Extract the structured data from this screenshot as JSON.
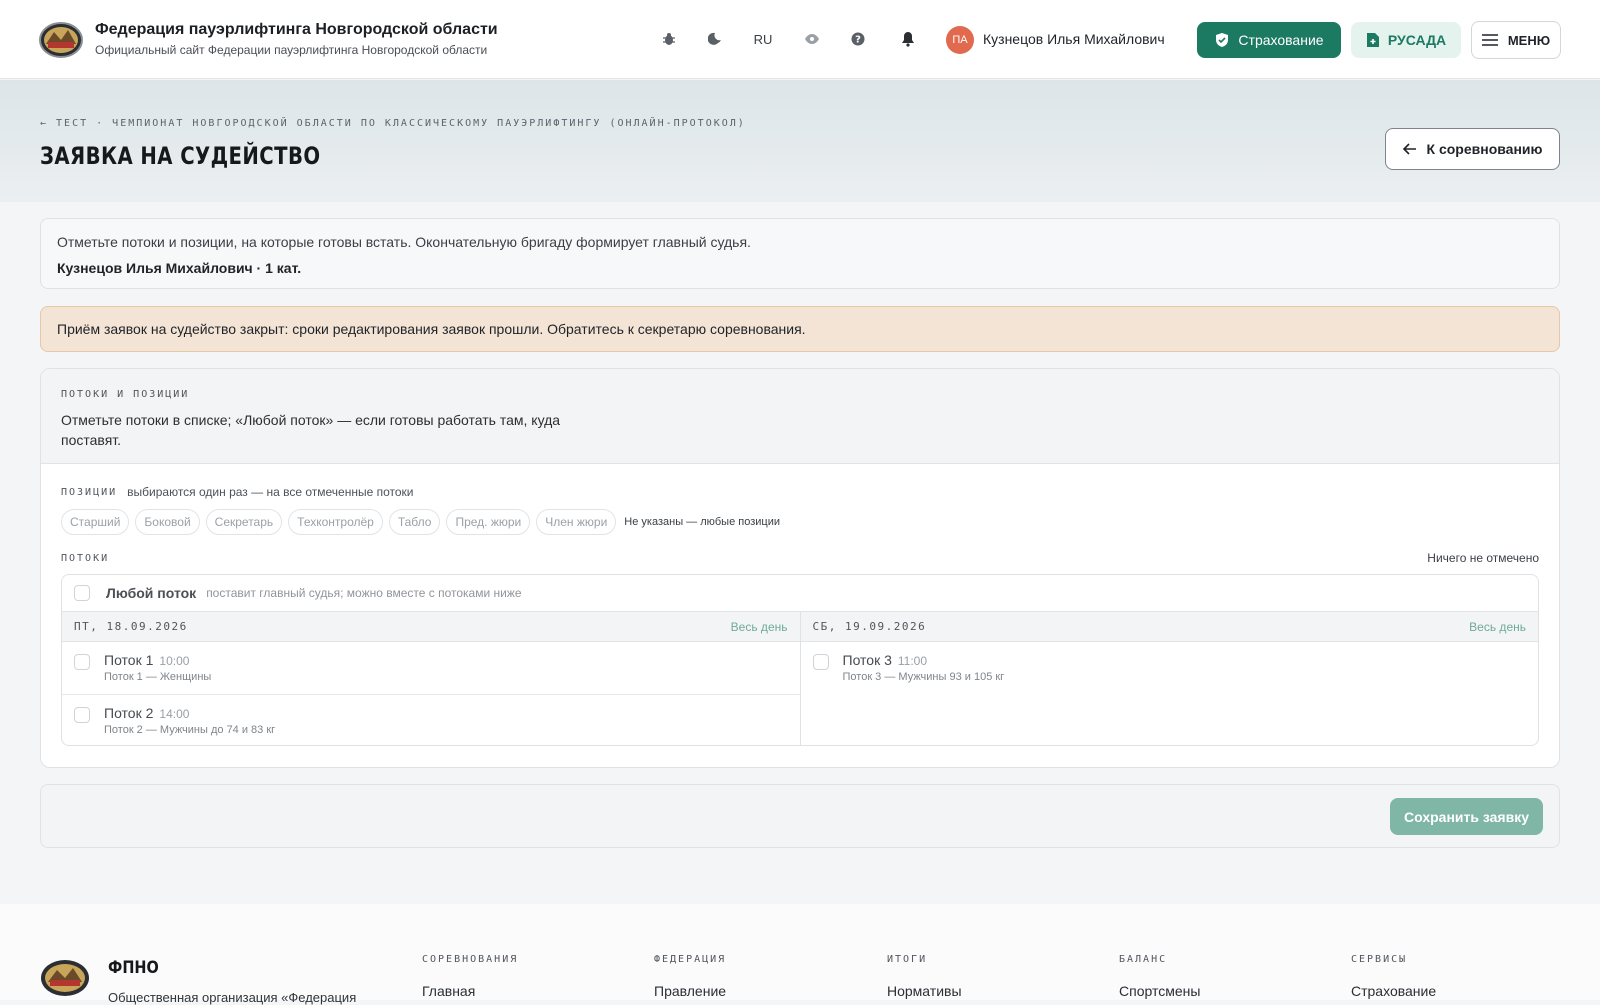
{
  "header": {
    "title": "Федерация пауэрлифтинга Новгородской области",
    "subtitle": "Официальный сайт Федерации пауэрлифтинга Новгородской области",
    "lang": "RU",
    "avatar_initials": "ПА",
    "user_name": "Кузнецов Илья Михайлович",
    "insurance_label": "Страхование",
    "rusada_label": "РУСАДА",
    "menu_label": "МЕНЮ"
  },
  "hero": {
    "breadcrumb": "← ТЕСТ · ЧЕМПИОНАТ НОВГОРОДСКОЙ ОБЛАСТИ ПО КЛАССИЧЕСКОМУ ПАУЭРЛИФТИНГУ (ОНЛАЙН-ПРОТОКОЛ)",
    "title": "ЗАЯВКА НА СУДЕЙСТВО",
    "back_label": "К соревнованию"
  },
  "info": {
    "text": "Отметьте потоки и позиции, на которые готовы встать. Окончательную бригаду формирует главный судья.",
    "judge": "Кузнецов Илья Михайлович · 1 кат."
  },
  "warning": "Приём заявок на судейство закрыт: сроки редактирования заявок прошли. Обратитесь к секретарю соревнования.",
  "main": {
    "section_label": "ПОТОКИ И ПОЗИЦИИ",
    "description": "Отметьте потоки в списке; «Любой поток» — если готовы работать там, куда поставят.",
    "positions_label": "ПОЗИЦИИ",
    "positions_hint": "выбираются один раз — на все отмеченные потоки",
    "positions": [
      "Старший",
      "Боковой",
      "Секретарь",
      "Техконтролёр",
      "Табло",
      "Пред. жюри",
      "Член жюри"
    ],
    "positions_note": "Не указаны — любые позиции",
    "streams_label": "ПОТОКИ",
    "nothing_selected": "Ничего не отмечено",
    "any_stream": {
      "label": "Любой поток",
      "hint": "поставит главный судья; можно вместе с потоками ниже"
    },
    "days": [
      {
        "date": "ПТ, 18.09.2026",
        "whole_day": "Весь день",
        "streams": [
          {
            "title": "Поток 1",
            "time": "10:00",
            "desc": "Поток 1 — Женщины"
          },
          {
            "title": "Поток 2",
            "time": "14:00",
            "desc": "Поток 2 — Мужчины до 74 и 83 кг"
          }
        ]
      },
      {
        "date": "СБ, 19.09.2026",
        "whole_day": "Весь день",
        "streams": [
          {
            "title": "Поток 3",
            "time": "11:00",
            "desc": "Поток 3 — Мужчины 93 и 105 кг"
          }
        ]
      }
    ]
  },
  "save_label": "Сохранить заявку",
  "footer": {
    "brand": "ФПНО",
    "org": "Общественная организация «Федерация",
    "columns": [
      {
        "title": "СОРЕВНОВАНИЯ",
        "link": "Главная"
      },
      {
        "title": "ФЕДЕРАЦИЯ",
        "link": "Правление"
      },
      {
        "title": "ИТОГИ",
        "link": "Нормативы"
      },
      {
        "title": "БАЛАНС",
        "link": "Спортсмены"
      },
      {
        "title": "СЕРВИСЫ",
        "link": "Страхование"
      }
    ]
  },
  "colors": {
    "accent": "#1c7a62",
    "accent_light": "#e4f3ee",
    "warning_bg": "#f3e4d6",
    "avatar": "#e0694e"
  }
}
